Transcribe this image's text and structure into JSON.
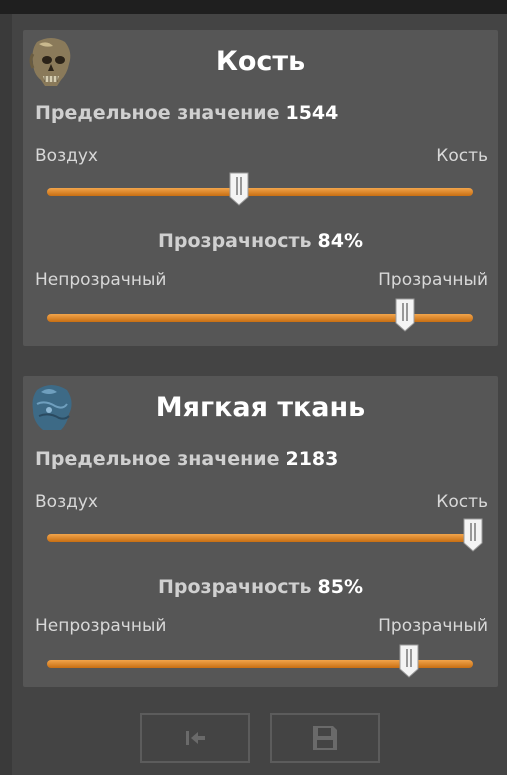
{
  "panels": [
    {
      "title": "Кость",
      "icon": "skull-bone-icon",
      "threshold_label": "Предельное значение",
      "threshold_value": "1544",
      "threshold_min_label": "Воздух",
      "threshold_max_label": "Кость",
      "threshold_position": 0.45,
      "opacity_label": "Прозрачность",
      "opacity_value": "84%",
      "opacity_min_label": "Непрозрачный",
      "opacity_max_label": "Прозрачный",
      "opacity_position": 0.84
    },
    {
      "title": "Мягкая ткань",
      "icon": "skull-soft-tissue-icon",
      "threshold_label": "Предельное значение",
      "threshold_value": "2183",
      "threshold_min_label": "Воздух",
      "threshold_max_label": "Кость",
      "threshold_position": 1.0,
      "opacity_label": "Прозрачность",
      "opacity_value": "85%",
      "opacity_min_label": "Непрозрачный",
      "opacity_max_label": "Прозрачный",
      "opacity_position": 0.85
    }
  ],
  "toolbar": {
    "reset_icon": "reset-to-start-icon",
    "save_icon": "save-disk-icon"
  },
  "colors": {
    "slider_accent": "#e08a2a",
    "panel_bg": "#565656",
    "frame_bg": "#444444"
  }
}
